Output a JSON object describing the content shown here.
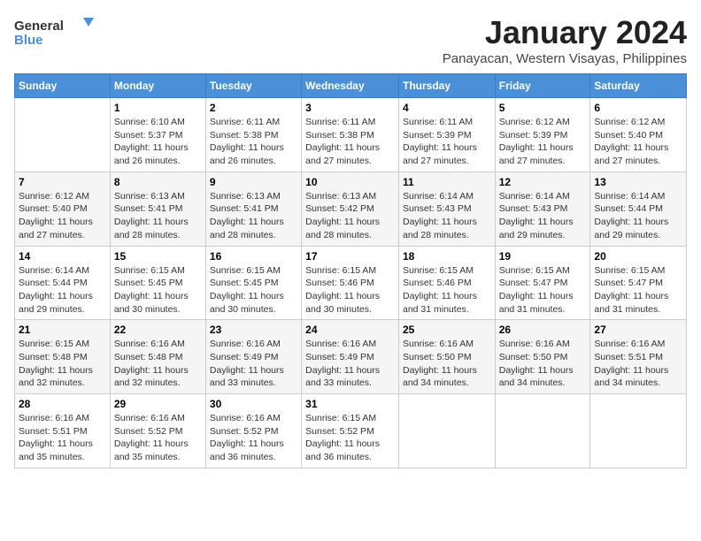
{
  "header": {
    "logo_line1": "General",
    "logo_line2": "Blue",
    "title": "January 2024",
    "subtitle": "Panayacan, Western Visayas, Philippines"
  },
  "days": [
    "Sunday",
    "Monday",
    "Tuesday",
    "Wednesday",
    "Thursday",
    "Friday",
    "Saturday"
  ],
  "weeks": [
    [
      {
        "day": "",
        "sunrise": "",
        "sunset": "",
        "daylight": ""
      },
      {
        "day": "1",
        "sunrise": "6:10 AM",
        "sunset": "5:37 PM",
        "daylight": "11 hours and 26 minutes."
      },
      {
        "day": "2",
        "sunrise": "6:11 AM",
        "sunset": "5:38 PM",
        "daylight": "11 hours and 26 minutes."
      },
      {
        "day": "3",
        "sunrise": "6:11 AM",
        "sunset": "5:38 PM",
        "daylight": "11 hours and 27 minutes."
      },
      {
        "day": "4",
        "sunrise": "6:11 AM",
        "sunset": "5:39 PM",
        "daylight": "11 hours and 27 minutes."
      },
      {
        "day": "5",
        "sunrise": "6:12 AM",
        "sunset": "5:39 PM",
        "daylight": "11 hours and 27 minutes."
      },
      {
        "day": "6",
        "sunrise": "6:12 AM",
        "sunset": "5:40 PM",
        "daylight": "11 hours and 27 minutes."
      }
    ],
    [
      {
        "day": "7",
        "sunrise": "6:12 AM",
        "sunset": "5:40 PM",
        "daylight": "11 hours and 27 minutes."
      },
      {
        "day": "8",
        "sunrise": "6:13 AM",
        "sunset": "5:41 PM",
        "daylight": "11 hours and 28 minutes."
      },
      {
        "day": "9",
        "sunrise": "6:13 AM",
        "sunset": "5:41 PM",
        "daylight": "11 hours and 28 minutes."
      },
      {
        "day": "10",
        "sunrise": "6:13 AM",
        "sunset": "5:42 PM",
        "daylight": "11 hours and 28 minutes."
      },
      {
        "day": "11",
        "sunrise": "6:14 AM",
        "sunset": "5:43 PM",
        "daylight": "11 hours and 28 minutes."
      },
      {
        "day": "12",
        "sunrise": "6:14 AM",
        "sunset": "5:43 PM",
        "daylight": "11 hours and 29 minutes."
      },
      {
        "day": "13",
        "sunrise": "6:14 AM",
        "sunset": "5:44 PM",
        "daylight": "11 hours and 29 minutes."
      }
    ],
    [
      {
        "day": "14",
        "sunrise": "6:14 AM",
        "sunset": "5:44 PM",
        "daylight": "11 hours and 29 minutes."
      },
      {
        "day": "15",
        "sunrise": "6:15 AM",
        "sunset": "5:45 PM",
        "daylight": "11 hours and 30 minutes."
      },
      {
        "day": "16",
        "sunrise": "6:15 AM",
        "sunset": "5:45 PM",
        "daylight": "11 hours and 30 minutes."
      },
      {
        "day": "17",
        "sunrise": "6:15 AM",
        "sunset": "5:46 PM",
        "daylight": "11 hours and 30 minutes."
      },
      {
        "day": "18",
        "sunrise": "6:15 AM",
        "sunset": "5:46 PM",
        "daylight": "11 hours and 31 minutes."
      },
      {
        "day": "19",
        "sunrise": "6:15 AM",
        "sunset": "5:47 PM",
        "daylight": "11 hours and 31 minutes."
      },
      {
        "day": "20",
        "sunrise": "6:15 AM",
        "sunset": "5:47 PM",
        "daylight": "11 hours and 31 minutes."
      }
    ],
    [
      {
        "day": "21",
        "sunrise": "6:15 AM",
        "sunset": "5:48 PM",
        "daylight": "11 hours and 32 minutes."
      },
      {
        "day": "22",
        "sunrise": "6:16 AM",
        "sunset": "5:48 PM",
        "daylight": "11 hours and 32 minutes."
      },
      {
        "day": "23",
        "sunrise": "6:16 AM",
        "sunset": "5:49 PM",
        "daylight": "11 hours and 33 minutes."
      },
      {
        "day": "24",
        "sunrise": "6:16 AM",
        "sunset": "5:49 PM",
        "daylight": "11 hours and 33 minutes."
      },
      {
        "day": "25",
        "sunrise": "6:16 AM",
        "sunset": "5:50 PM",
        "daylight": "11 hours and 34 minutes."
      },
      {
        "day": "26",
        "sunrise": "6:16 AM",
        "sunset": "5:50 PM",
        "daylight": "11 hours and 34 minutes."
      },
      {
        "day": "27",
        "sunrise": "6:16 AM",
        "sunset": "5:51 PM",
        "daylight": "11 hours and 34 minutes."
      }
    ],
    [
      {
        "day": "28",
        "sunrise": "6:16 AM",
        "sunset": "5:51 PM",
        "daylight": "11 hours and 35 minutes."
      },
      {
        "day": "29",
        "sunrise": "6:16 AM",
        "sunset": "5:52 PM",
        "daylight": "11 hours and 35 minutes."
      },
      {
        "day": "30",
        "sunrise": "6:16 AM",
        "sunset": "5:52 PM",
        "daylight": "11 hours and 36 minutes."
      },
      {
        "day": "31",
        "sunrise": "6:15 AM",
        "sunset": "5:52 PM",
        "daylight": "11 hours and 36 minutes."
      },
      {
        "day": "",
        "sunrise": "",
        "sunset": "",
        "daylight": ""
      },
      {
        "day": "",
        "sunrise": "",
        "sunset": "",
        "daylight": ""
      },
      {
        "day": "",
        "sunrise": "",
        "sunset": "",
        "daylight": ""
      }
    ]
  ]
}
